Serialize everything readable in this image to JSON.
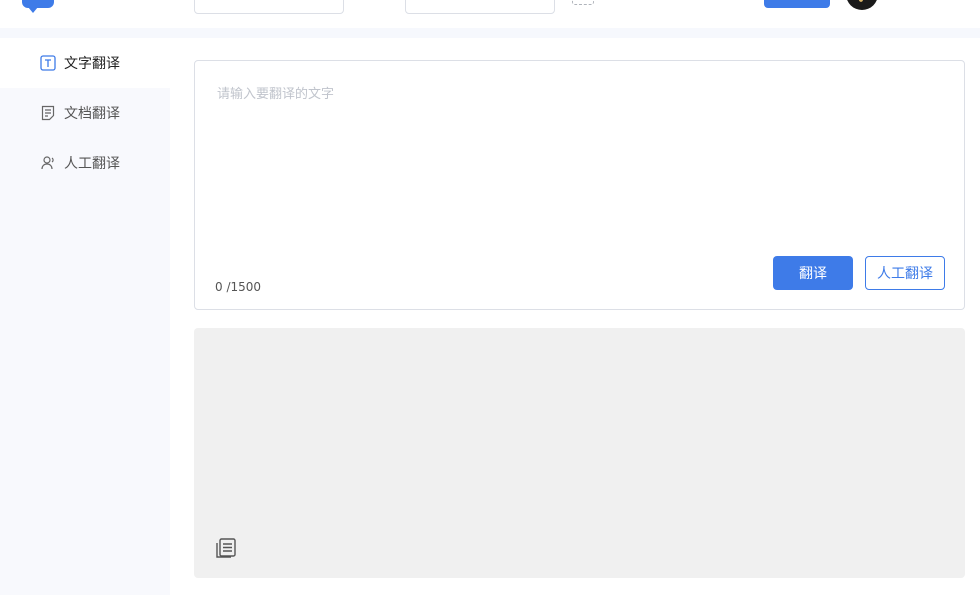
{
  "header": {
    "accent_color": "#3e7be8",
    "logo_icon": "chat-bubble-icon",
    "swap_icon": "swap-languages-icon",
    "avatar_icon": "user-avatar"
  },
  "sidebar": {
    "items": [
      {
        "label": "文字翻译",
        "icon": "text-T-icon",
        "active": true
      },
      {
        "label": "文档翻译",
        "icon": "document-icon",
        "active": false
      },
      {
        "label": "人工翻译",
        "icon": "human-translator-icon",
        "active": false
      }
    ]
  },
  "input": {
    "placeholder": "请输入要翻译的文字",
    "value": "",
    "char_count": "0",
    "char_limit": "/1500"
  },
  "actions": {
    "translate_label": "翻译",
    "human_translate_label": "人工翻译"
  },
  "output": {
    "text": "",
    "copy_icon": "copy-icon"
  }
}
